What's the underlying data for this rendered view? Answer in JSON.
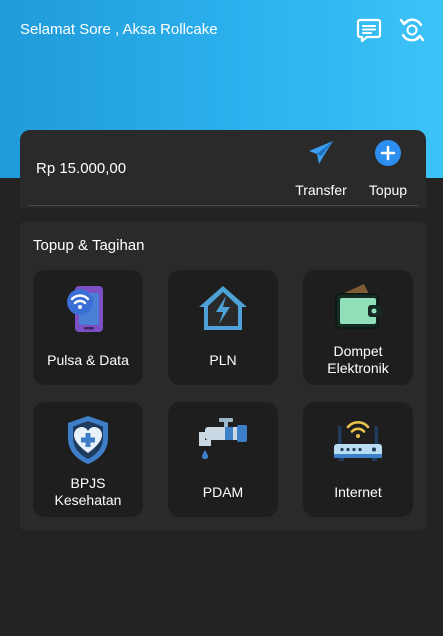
{
  "header": {
    "greeting": "Selamat Sore , Aksa Rollcake",
    "icons": [
      "message-icon",
      "sync-icon"
    ],
    "accent_color": "#2cb1ee"
  },
  "balance": {
    "amount": "Rp 15.000,00",
    "actions": [
      {
        "label": "Transfer",
        "icon": "paper-plane-icon"
      },
      {
        "label": "Topup",
        "icon": "plus-circle-icon"
      }
    ]
  },
  "services": {
    "title": "Topup & Tagihan",
    "items": [
      {
        "label": "Pulsa & Data",
        "icon": "phone-wifi-icon"
      },
      {
        "label": "PLN",
        "icon": "electric-house-icon"
      },
      {
        "label": "Dompet\nElektronik",
        "icon": "wallet-icon"
      },
      {
        "label": "BPJS\nKesehatan",
        "icon": "health-shield-icon"
      },
      {
        "label": "PDAM",
        "icon": "water-faucet-icon"
      },
      {
        "label": "Internet",
        "icon": "router-icon"
      }
    ]
  }
}
